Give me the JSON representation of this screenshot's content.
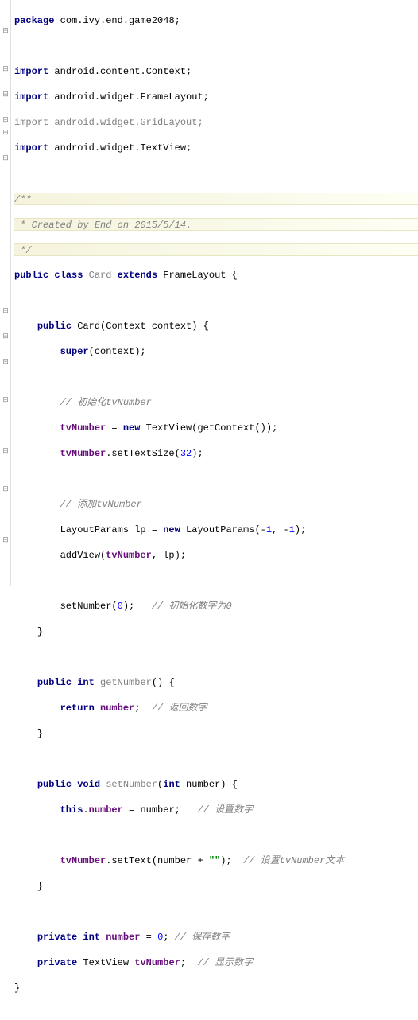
{
  "code": {
    "l1_package": "package",
    "l1_pkg": " com.ivy.end.game2048;",
    "l3_import": "import",
    "l3_pkg": " android.content.Context;",
    "l4_import": "import",
    "l4_pkg": " android.widget.FrameLayout;",
    "l5_import": "import",
    "l5_pkg": " android.widget.GridLayout;",
    "l6_import": "import",
    "l6_pkg": " android.widget.TextView;",
    "l8_doc1": "/**",
    "l9_doc2": " * Created by End on 2015/5/14.",
    "l10_doc3": " */",
    "l11_public": "public class",
    "l11_class": " Card ",
    "l11_extends": "extends",
    "l11_super": " FrameLayout {",
    "l13_pub": "public",
    "l13_ctor": " Card(Context context) {",
    "l14_super": "super",
    "l14_rest": "(context);",
    "l16_cmt": "// 初始化tvNumber",
    "l17_field": "tvNumber",
    "l17_eq": " = ",
    "l17_new": "new",
    "l17_rest": " TextView(getContext());",
    "l18_field": "tvNumber",
    "l18_rest": ".setTextSize(",
    "l18_num": "32",
    "l18_end": ");",
    "l20_cmt": "// 添加tvNumber",
    "l21_rest": "LayoutParams lp = ",
    "l21_new": "new",
    "l21_rest2": " LayoutParams(-",
    "l21_n1": "1",
    "l21_c": ", -",
    "l21_n2": "1",
    "l21_end": ");",
    "l22_addview": "addView(",
    "l22_field": "tvNumber",
    "l22_rest": ", lp);",
    "l24_call": "setNumber(",
    "l24_num": "0",
    "l24_end": ");   ",
    "l24_cmt": "// 初始化数字为0",
    "l25_brace": "}",
    "l27_pub": "public int",
    "l27_method": " getNumber",
    "l27_rest": "() {",
    "l28_ret": "return",
    "l28_sp": " ",
    "l28_field": "number",
    "l28_end": ";  ",
    "l28_cmt": "// 返回数字",
    "l29_brace": "}",
    "l31_pub": "public void",
    "l31_method": " setNumber",
    "l31_rest": "(",
    "l31_int": "int",
    "l31_param": " number) {",
    "l32_this": "this",
    "l32_dot": ".",
    "l32_field": "number",
    "l32_eq": " = number;   ",
    "l32_cmt": "// 设置数字",
    "l34_field": "tvNumber",
    "l34_rest": ".setText(number + ",
    "l34_str": "\"\"",
    "l34_end": ");  ",
    "l34_cmt": "// 设置tvNumber文本",
    "l35_brace": "}",
    "l37_priv": "private int",
    "l37_sp": " ",
    "l37_field": "number",
    "l37_eq": " = ",
    "l37_num": "0",
    "l37_end": "; ",
    "l37_cmt": "// 保存数字",
    "l38_priv": "private",
    "l38_type": " TextView ",
    "l38_field": "tvNumber",
    "l38_end": ";  ",
    "l38_cmt": "// 显示数字",
    "l39_brace": "}"
  }
}
